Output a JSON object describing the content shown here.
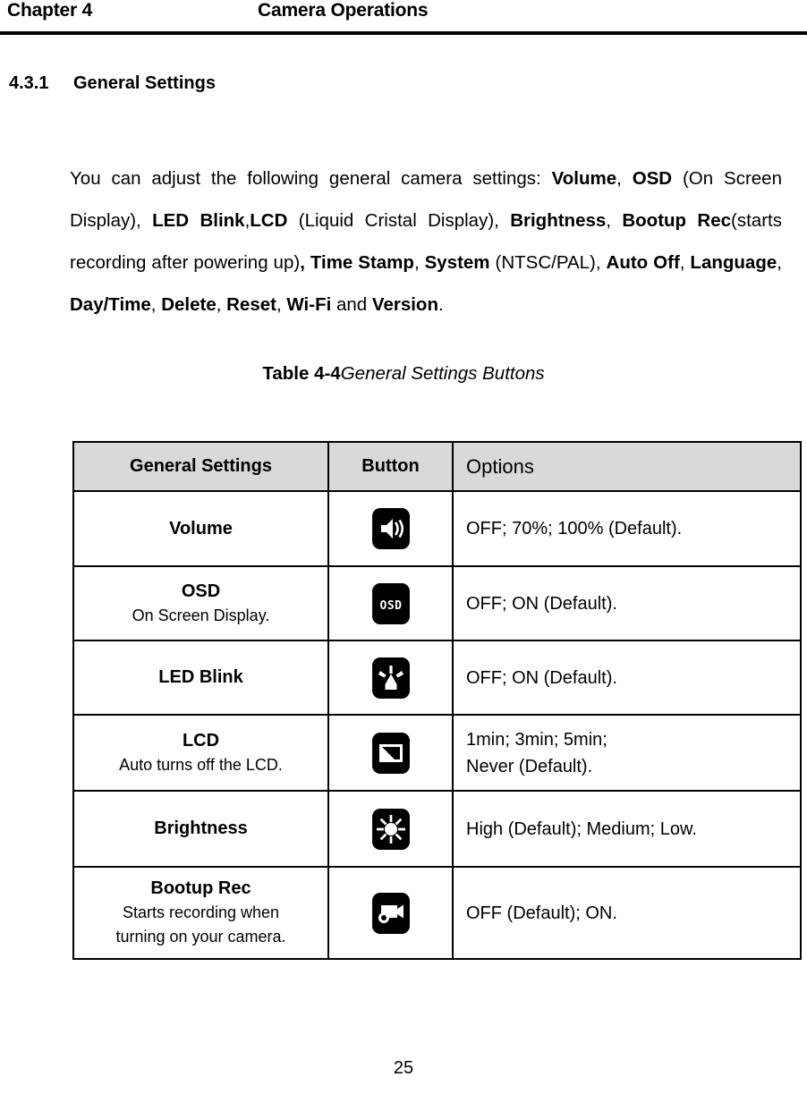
{
  "header": {
    "chapter": "Chapter 4",
    "title": "Camera Operations"
  },
  "section": {
    "number": "4.3.1",
    "title": "General Settings"
  },
  "paragraph": {
    "full_text": "You can adjust the following general camera settings: Volume, OSD (On Screen Display), LED Blink,LCD (Liquid Cristal Display), Brightness, Bootup Rec(starts recording after powering up), Time Stamp, System (NTSC/PAL), Auto Off, Language, Day/Time, Delete, Reset, Wi-Fi and Version.",
    "intro": "You can adjust the following general camera settings: ",
    "t1": "Volume",
    "s1": ", ",
    "t2": "OSD",
    "s2": " (On Screen Display), ",
    "t3": "LED Blink",
    "s3": ",",
    "t4": "LCD",
    "s4": " (Liquid Cristal Display), ",
    "t5": "Brightness",
    "s5": ", ",
    "t6": "Bootup Rec",
    "s6": "(starts recording after powering up)",
    "s6b": ", ",
    "t7": "Time Stamp",
    "s7": ", ",
    "t8": "System",
    "s8": " (NTSC/PAL), ",
    "t9": "Auto Off",
    "s9": ", ",
    "t10": "Language",
    "s10": ", ",
    "t11": "Day/Time",
    "s11": ", ",
    "t12": "Delete",
    "s12": ", ",
    "t13": "Reset",
    "s13": ", ",
    "t14": "Wi-Fi",
    "s14": " and ",
    "t15": "Version",
    "s15": "."
  },
  "table_caption": {
    "number": "Table 4-4",
    "text": "General Settings Buttons"
  },
  "table": {
    "headers": {
      "setting": "General Settings",
      "button": "Button",
      "options": "Options"
    },
    "header_bg": "#d9d9d9",
    "rows": [
      {
        "name": "Volume",
        "desc": "",
        "icon": "speaker-icon",
        "options": [
          "OFF; 70%; 100% (Default)."
        ]
      },
      {
        "name": "OSD",
        "desc": "On Screen Display.",
        "icon": "osd-icon",
        "options": [
          "OFF; ON (Default)."
        ]
      },
      {
        "name": "LED Blink",
        "desc": "",
        "icon": "led-blink-icon",
        "options": [
          "OFF; ON (Default)."
        ]
      },
      {
        "name": "LCD",
        "desc": "Auto turns off the LCD.",
        "icon": "lcd-screen-icon",
        "options": [
          "1min; 3min; 5min;",
          "Never (Default)."
        ]
      },
      {
        "name": "Brightness",
        "desc": "",
        "icon": "brightness-sun-icon",
        "options": [
          "High (Default); Medium; Low."
        ]
      },
      {
        "name": "Bootup Rec",
        "desc": "Starts recording when turning on your camera.",
        "desc_line1": "Starts recording when",
        "desc_line2": "turning on your camera.",
        "icon": "camcorder-icon",
        "options": [
          "OFF (Default); ON."
        ]
      }
    ]
  },
  "page_number": "25"
}
